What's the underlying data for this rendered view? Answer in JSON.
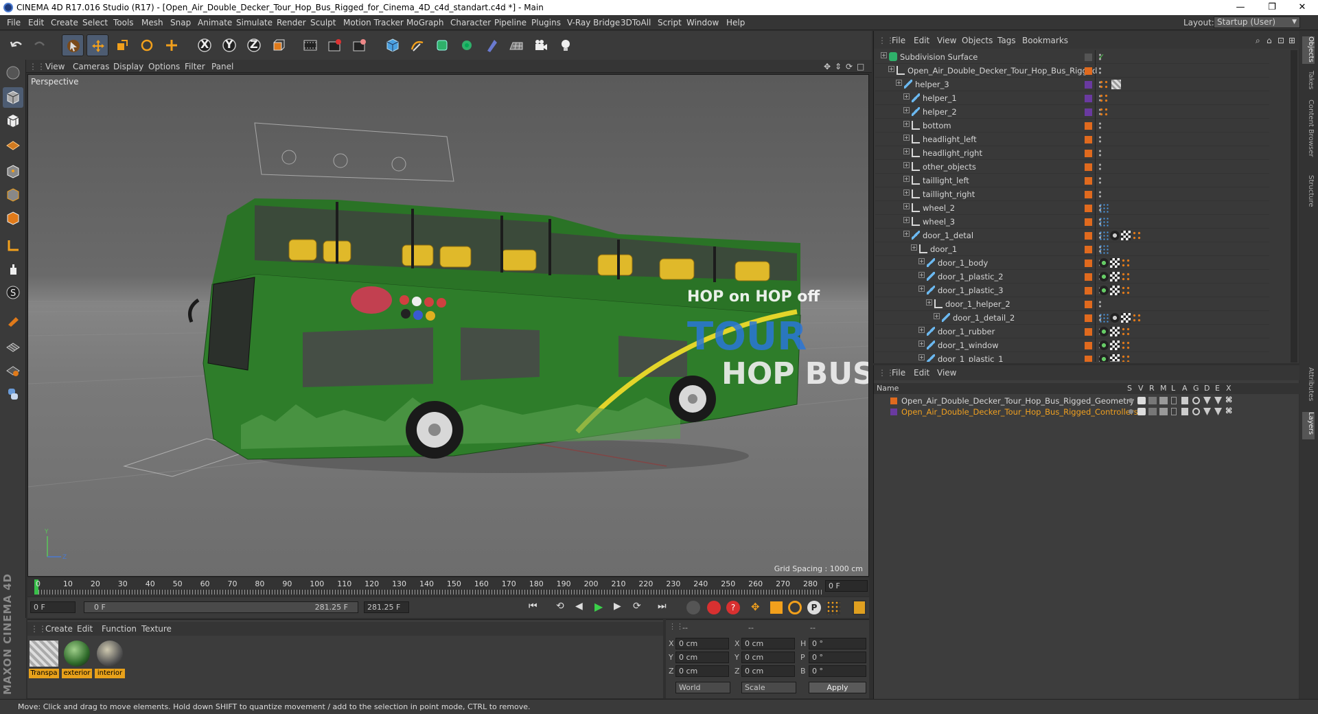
{
  "titlebar": {
    "title": "CINEMA 4D R17.016 Studio (R17) - [Open_Air_Double_Decker_Tour_Hop_Bus_Rigged_for_Cinema_4D_c4d_standart.c4d *] - Main",
    "minimize": "—",
    "maximize": "❐",
    "close": "✕"
  },
  "menubar": {
    "items": [
      "File",
      "Edit",
      "Create",
      "Select",
      "Tools",
      "Mesh",
      "Snap",
      "Animate",
      "Simulate",
      "Render",
      "Sculpt",
      "Motion Tracker",
      "MoGraph",
      "Character",
      "Pipeline",
      "Plugins",
      "V-Ray Bridge",
      "3DToAll",
      "Script",
      "Window",
      "Help"
    ],
    "layout_label": "Layout:",
    "layout_value": "Startup (User)"
  },
  "toolbar": {
    "icons": [
      "undo-icon",
      "redo-icon",
      "select-arrow-icon",
      "move-icon",
      "scale-icon",
      "rotate-icon",
      "live-select-icon",
      "x-axis-icon",
      "y-axis-icon",
      "z-axis-icon",
      "world-coord-icon",
      "render-view-icon",
      "render-picture-icon",
      "render-settings-icon",
      "cube-icon",
      "pen-spline-icon",
      "subdivision-icon",
      "array-icon",
      "deformer-icon",
      "floor-icon",
      "camera-icon",
      "light-icon"
    ],
    "axis_x": "X",
    "axis_y": "Y",
    "axis_z": "Z"
  },
  "viewport_menu": {
    "items": [
      "View",
      "Cameras",
      "Display",
      "Options",
      "Filter",
      "Panel"
    ]
  },
  "viewport": {
    "camera_label": "Perspective",
    "grid_spacing": "Grid Spacing : 1000 cm",
    "bus_text_hop": "HOP on HOP off",
    "bus_text_tour": "TOUR",
    "bus_text_hopbus": "HOP BUS"
  },
  "timeline": {
    "ticks": [
      "0",
      "10",
      "20",
      "30",
      "40",
      "50",
      "60",
      "70",
      "80",
      "90",
      "100",
      "110",
      "120",
      "130",
      "140",
      "150",
      "160",
      "170",
      "180",
      "190",
      "200",
      "210",
      "220",
      "230",
      "240",
      "250",
      "260",
      "270",
      "280"
    ],
    "current_frame": "0 F"
  },
  "transport": {
    "start_field": "0 F",
    "slider_start": "0 F",
    "slider_end": "281.25 F",
    "end_field": "281.25 F"
  },
  "material_panel": {
    "menu": [
      "Create",
      "Edit",
      "Function",
      "Texture"
    ],
    "materials": [
      {
        "name": "Transpa"
      },
      {
        "name": "exterior"
      },
      {
        "name": "interior"
      }
    ]
  },
  "attr_panel": {
    "header": [
      "--",
      "--",
      "--"
    ],
    "rows": [
      {
        "a": "X",
        "av": "0 cm",
        "b": "X",
        "bv": "0 cm",
        "c": "H",
        "cv": "0 °"
      },
      {
        "a": "Y",
        "av": "0 cm",
        "b": "Y",
        "bv": "0 cm",
        "c": "P",
        "cv": "0 °"
      },
      {
        "a": "Z",
        "av": "0 cm",
        "b": "Z",
        "bv": "0 cm",
        "c": "B",
        "cv": "0 °"
      }
    ],
    "coord_mode": "World",
    "size_mode": "Scale",
    "apply": "Apply"
  },
  "logo": {
    "text": "MAXON CINEMA 4D"
  },
  "status": {
    "text": "Move: Click and drag to move elements. Hold down SHIFT to quantize movement / add to the selection in point mode, CTRL to remove."
  },
  "object_manager": {
    "menu": [
      "File",
      "Edit",
      "View",
      "Objects",
      "Tags",
      "Bookmarks"
    ],
    "rows": [
      {
        "name": "Subdivision Surface",
        "indent": 0,
        "icon": "subdivision-icon",
        "color": "#555555",
        "tags": "check"
      },
      {
        "name": "Open_Air_Double_Decker_Tour_Hop_Bus_Rigged",
        "indent": 1,
        "icon": "null-object-icon",
        "color": "#e06a1e",
        "tags": ""
      },
      {
        "name": "helper_3",
        "indent": 2,
        "icon": "joint-icon",
        "color": "#6a3aa0",
        "tags": "dots-tex"
      },
      {
        "name": "helper_1",
        "indent": 3,
        "icon": "joint-icon",
        "color": "#6a3aa0",
        "tags": "dots"
      },
      {
        "name": "helper_2",
        "indent": 3,
        "icon": "joint-icon",
        "color": "#6a3aa0",
        "tags": "dots"
      },
      {
        "name": "bottom",
        "indent": 3,
        "icon": "null-object-icon",
        "color": "#e06a1e",
        "tags": ""
      },
      {
        "name": "headlight_left",
        "indent": 3,
        "icon": "null-object-icon",
        "color": "#e06a1e",
        "tags": ""
      },
      {
        "name": "headlight_right",
        "indent": 3,
        "icon": "null-object-icon",
        "color": "#e06a1e",
        "tags": ""
      },
      {
        "name": "other_objects",
        "indent": 3,
        "icon": "null-object-icon",
        "color": "#e06a1e",
        "tags": ""
      },
      {
        "name": "taillight_left",
        "indent": 3,
        "icon": "null-object-icon",
        "color": "#e06a1e",
        "tags": ""
      },
      {
        "name": "taillight_right",
        "indent": 3,
        "icon": "null-object-icon",
        "color": "#e06a1e",
        "tags": ""
      },
      {
        "name": "wheel_2",
        "indent": 3,
        "icon": "null-object-icon",
        "color": "#e06a1e",
        "tags": "bluedots"
      },
      {
        "name": "wheel_3",
        "indent": 3,
        "icon": "null-object-icon",
        "color": "#e06a1e",
        "tags": "bluedots"
      },
      {
        "name": "door_1_detal",
        "indent": 3,
        "icon": "joint-icon",
        "color": "#e06a1e",
        "tags": "full"
      },
      {
        "name": "door_1",
        "indent": 4,
        "icon": "null-object-icon",
        "color": "#e06a1e",
        "tags": "bluedots"
      },
      {
        "name": "door_1_body",
        "indent": 5,
        "icon": "joint-icon",
        "color": "#e06a1e",
        "tags": "mat"
      },
      {
        "name": "door_1_plastic_2",
        "indent": 5,
        "icon": "joint-icon",
        "color": "#e06a1e",
        "tags": "mat"
      },
      {
        "name": "door_1_plastic_3",
        "indent": 5,
        "icon": "joint-icon",
        "color": "#e06a1e",
        "tags": "mat"
      },
      {
        "name": "door_1_helper_2",
        "indent": 6,
        "icon": "null-object-icon",
        "color": "#e06a1e",
        "tags": ""
      },
      {
        "name": "door_1_detail_2",
        "indent": 7,
        "icon": "joint-icon",
        "color": "#e06a1e",
        "tags": "full"
      },
      {
        "name": "door_1_rubber",
        "indent": 5,
        "icon": "joint-icon",
        "color": "#e06a1e",
        "tags": "mat"
      },
      {
        "name": "door_1_window",
        "indent": 5,
        "icon": "joint-icon",
        "color": "#e06a1e",
        "tags": "mat"
      },
      {
        "name": "door_1_plastic_1",
        "indent": 5,
        "icon": "joint-icon",
        "color": "#e06a1e",
        "tags": "mat"
      }
    ]
  },
  "layer_manager": {
    "menu": [
      "File",
      "Edit",
      "View"
    ],
    "columns": [
      "Name",
      "S",
      "V",
      "R",
      "M",
      "L",
      "A",
      "G",
      "D",
      "E",
      "X"
    ],
    "layers": [
      {
        "name": "Open_Air_Double_Decker_Tour_Hop_Bus_Rigged_Geometry",
        "color": "#e06a1e",
        "text_color": "#d6d6d6"
      },
      {
        "name": "Open_Air_Double_Decker_Tour_Hop_Bus_Rigged_Controllers",
        "color": "#6a3aa0",
        "text_color": "#f0a020"
      }
    ]
  },
  "right_tabs": [
    "Objects",
    "Takes",
    "Content Browser",
    "Structure",
    "Attributes",
    "Layers"
  ]
}
